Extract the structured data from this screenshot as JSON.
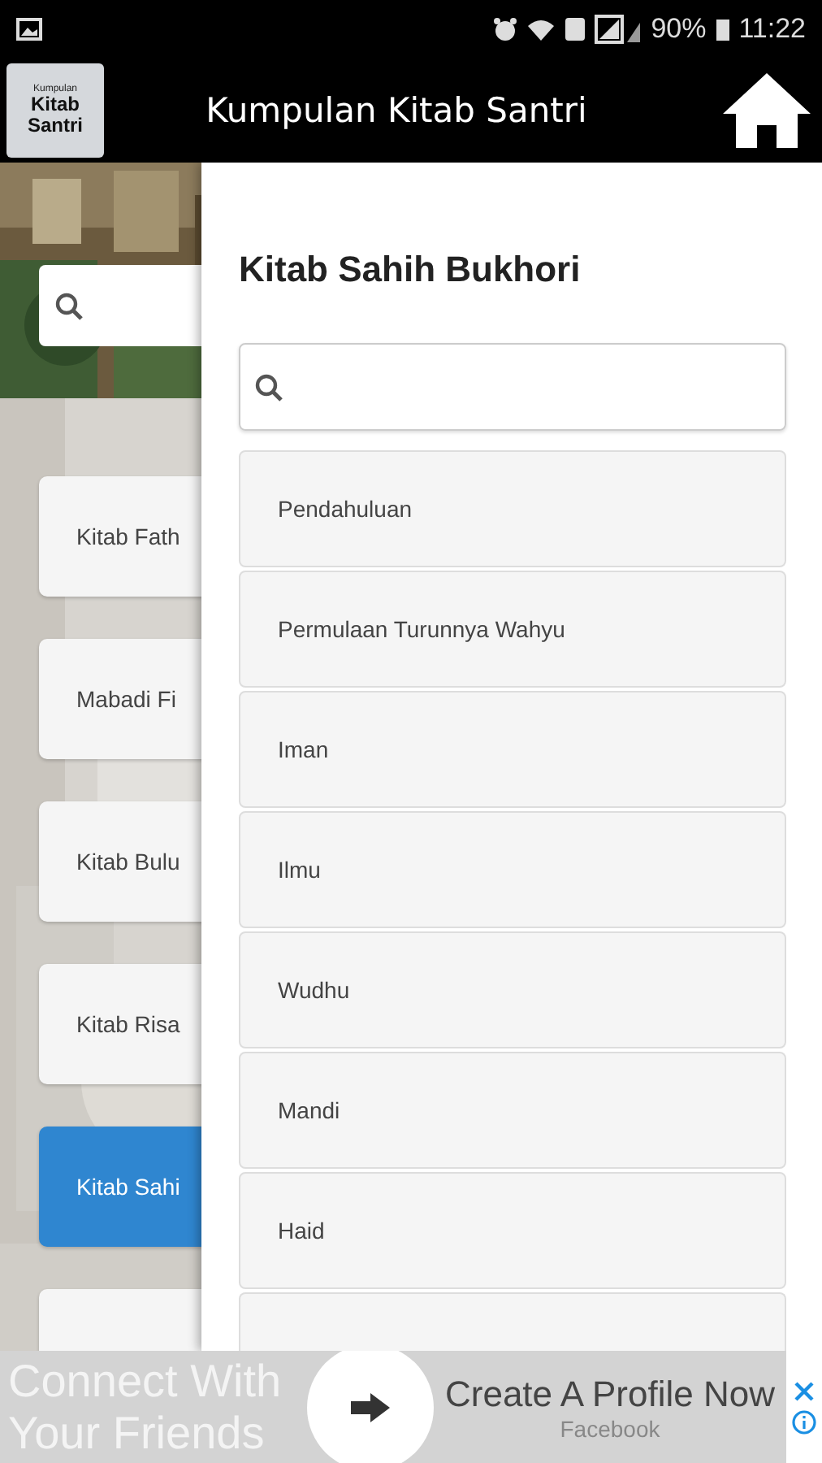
{
  "status_bar": {
    "battery": "90%",
    "time": "11:22"
  },
  "app_bar": {
    "logo_lines": [
      "Kumpulan",
      "Kitab",
      "Santri"
    ],
    "title": "Kumpulan Kitab Santri"
  },
  "background_list": {
    "items": [
      {
        "label": "Kitab Fath",
        "selected": false
      },
      {
        "label": "Mabadi Fi",
        "selected": false
      },
      {
        "label": "Kitab Bulu",
        "selected": false
      },
      {
        "label": "Kitab Risa",
        "selected": false
      },
      {
        "label": "Kitab Sahi",
        "selected": true
      },
      {
        "selected": false
      }
    ]
  },
  "drawer": {
    "title": "Kitab Sahih Bukhori",
    "items": [
      {
        "kind": "full",
        "label": "Pendahuluan"
      },
      {
        "kind": "full",
        "label": "Permulaan Turunnya Wahyu"
      },
      {
        "kind": "full",
        "label": "Iman"
      },
      {
        "kind": "full",
        "label": "Ilmu"
      },
      {
        "kind": "full",
        "label": "Wudhu"
      },
      {
        "kind": "full",
        "label": "Mandi"
      },
      {
        "kind": "full",
        "label": "Haid"
      },
      {
        "kind": "partial"
      }
    ]
  },
  "ad": {
    "headline_lines": [
      "Connect With",
      "Your Friends"
    ],
    "title": "Create A Profile Now",
    "advertiser": "Facebook"
  }
}
